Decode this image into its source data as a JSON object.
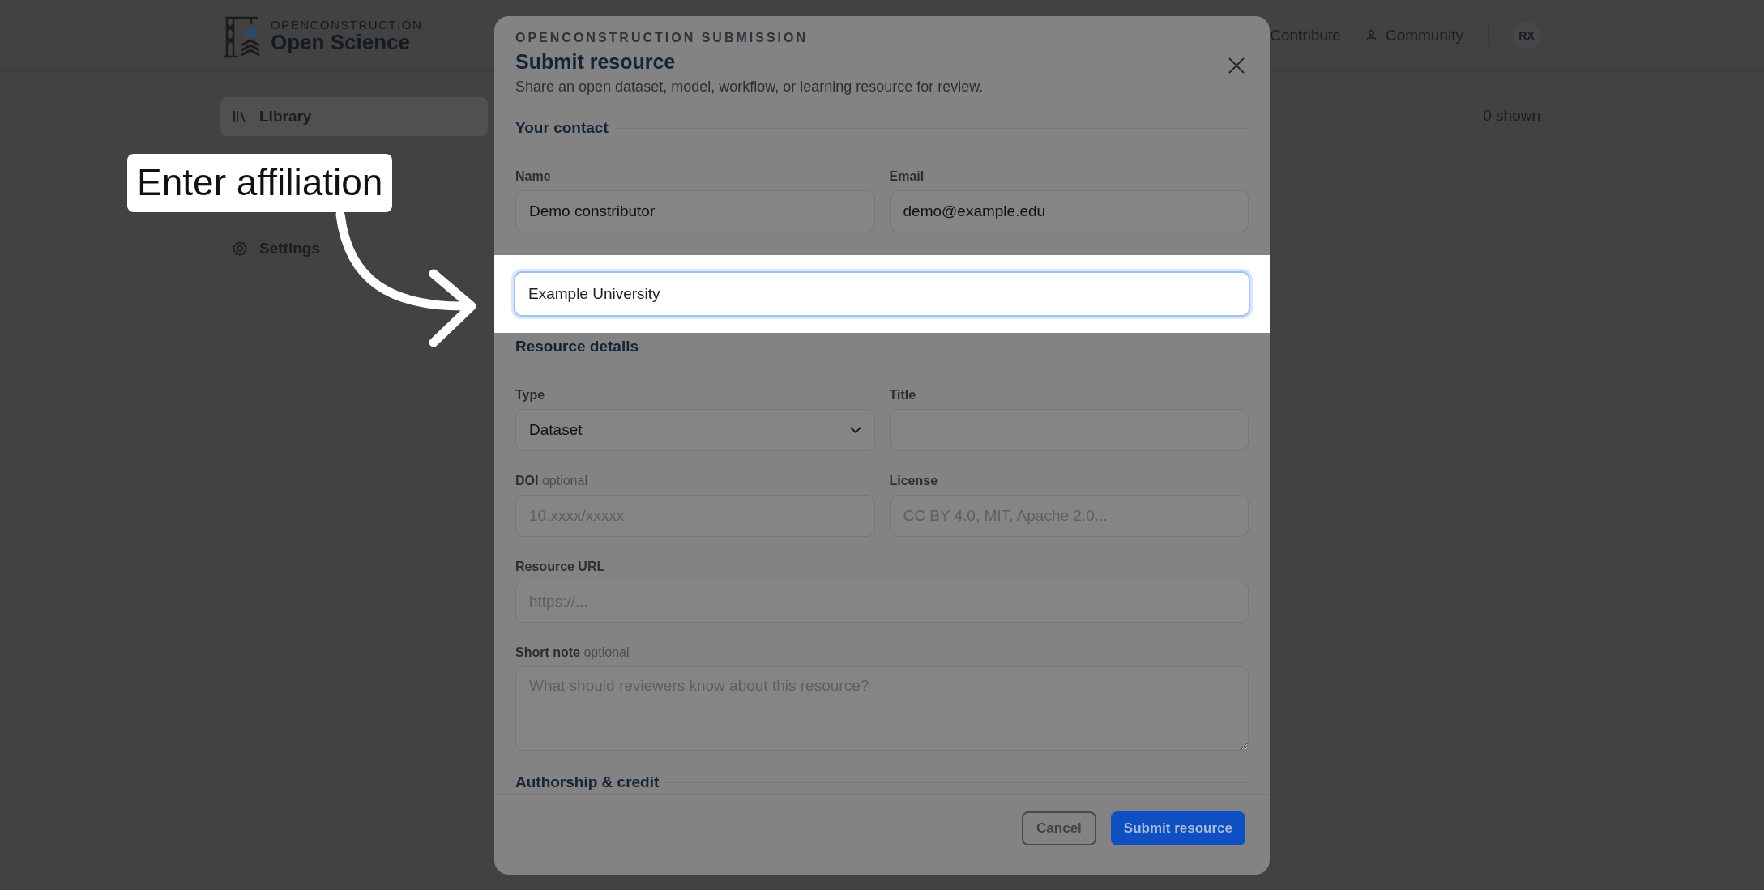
{
  "header": {
    "brand_top": "OPENCONSTRUCTION",
    "brand": "Open Science",
    "nav": [
      {
        "label": "Contribute",
        "kind": "plain"
      },
      {
        "label": "Community",
        "kind": "person"
      }
    ],
    "avatar": "RX"
  },
  "sidebar": {
    "items": [
      {
        "label": "Library",
        "selected": true
      },
      {
        "label": "Settings",
        "selected": false
      }
    ]
  },
  "main": {
    "count": "0 shown"
  },
  "dialog": {
    "eyebrow": "OPENCONSTRUCTION SUBMISSION",
    "title": "Submit resource",
    "subtitle": "Share an open dataset, model, workflow, or learning resource for review.",
    "sections": [
      {
        "heading": "Your contact",
        "rows": [
          [
            {
              "label": "Name",
              "kind": "text",
              "value": "Demo constributor",
              "focused": false
            },
            {
              "label": "Email",
              "kind": "text",
              "value": "demo@example.edu",
              "focused": false
            }
          ],
          [
            {
              "kind": "text",
              "value": "Example University",
              "focused": true
            }
          ]
        ]
      },
      {
        "heading": "Resource details",
        "rows": [
          [
            {
              "label": "Type",
              "kind": "select",
              "value": "Dataset",
              "focused": false
            },
            {
              "label": "Title",
              "kind": "text",
              "focused": false
            }
          ],
          [
            {
              "label": "DOI",
              "hint": "optional",
              "kind": "text",
              "placeholder": "10.xxxx/xxxxx",
              "focused": false
            },
            {
              "label": "License",
              "kind": "text",
              "placeholder": "CC BY 4.0, MIT, Apache 2.0...",
              "focused": false
            }
          ],
          [
            {
              "label": "Resource URL",
              "kind": "text",
              "placeholder": "https://...",
              "focused": false
            }
          ],
          [
            {
              "label": "Short note",
              "hint": "optional",
              "kind": "textarea",
              "placeholder": "What should reviewers know about this resource?",
              "focused": false
            }
          ]
        ]
      },
      {
        "heading": "Authorship & credit"
      }
    ],
    "buttons": [
      {
        "label": "Cancel",
        "kind": "secondary"
      },
      {
        "label": "Submit resource",
        "kind": "primary"
      }
    ]
  },
  "callout": {
    "text": "Enter affiliation"
  }
}
